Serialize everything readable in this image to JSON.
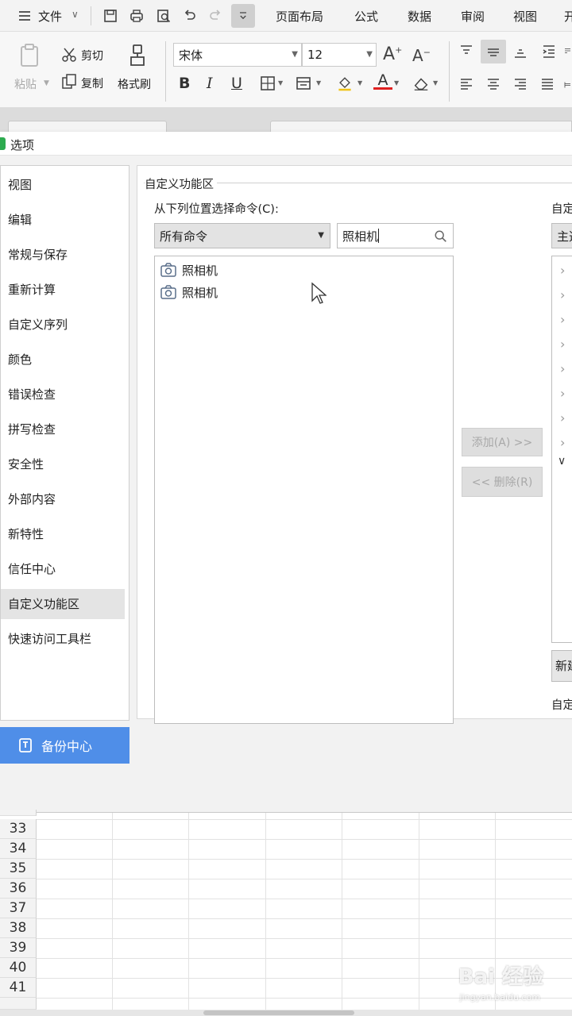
{
  "menubar": {
    "file_label": "文件",
    "tabs": [
      "页面布局",
      "公式",
      "数据",
      "审阅",
      "视图",
      "开"
    ]
  },
  "ribbon": {
    "paste_label": "粘贴",
    "cut_label": "剪切",
    "copy_label": "复制",
    "format_painter_label": "格式刷",
    "font_name": "宋体",
    "font_size": "12"
  },
  "dialog": {
    "title": "选项",
    "nav_items": [
      "视图",
      "编辑",
      "常规与保存",
      "重新计算",
      "自定义序列",
      "颜色",
      "错误检查",
      "拼写检查",
      "安全性",
      "外部内容",
      "新特性",
      "信任中心",
      "自定义功能区",
      "快速访问工具栏"
    ],
    "selected_nav": "自定义功能区",
    "backup_label": "备份中心",
    "group_title": "自定义功能区",
    "choose_label": "从下列位置选择命令(C):",
    "command_source": "所有命令",
    "search_value": "照相机",
    "commands": [
      "照相机",
      "照相机"
    ],
    "add_button": "添加(A) >>",
    "remove_button": "<< 删除(R)",
    "right_label": "自定",
    "right_select": "主选",
    "new_button": "新建",
    "right_bottom_label": "自定"
  },
  "sheet": {
    "row_numbers": [
      "33",
      "34",
      "35",
      "36",
      "37",
      "38",
      "39",
      "40",
      "41"
    ]
  },
  "watermark": {
    "text": "Bai 经验",
    "url": "jingyan.baidu.com"
  },
  "colors": {
    "accent": "#4f8ee8",
    "selected_nav_bg": "#e4e4e4"
  }
}
